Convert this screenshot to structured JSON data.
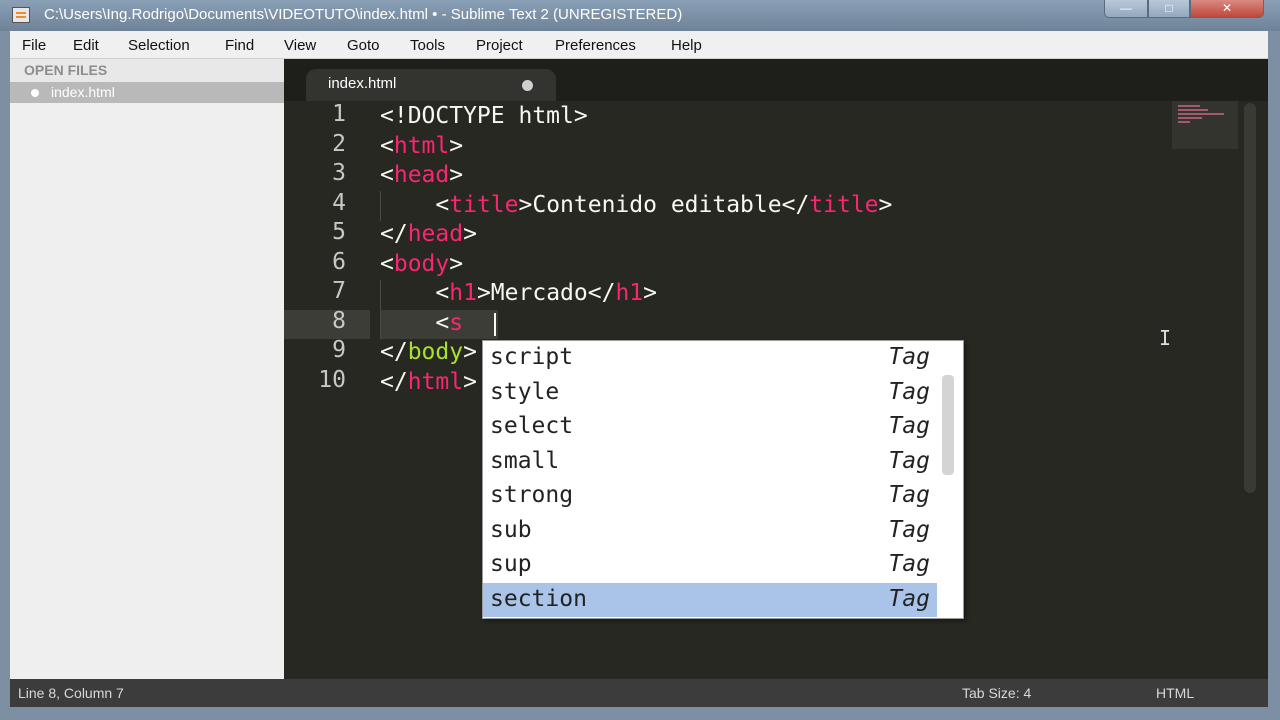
{
  "window": {
    "title": "C:\\Users\\Ing.Rodrigo\\Documents\\VIDEOTUTO\\index.html • - Sublime Text 2 (UNREGISTERED)",
    "minimize_label": "—",
    "maximize_label": "□",
    "close_label": "✕"
  },
  "menu": [
    "File",
    "Edit",
    "Selection",
    "Find",
    "View",
    "Goto",
    "Tools",
    "Project",
    "Preferences",
    "Help"
  ],
  "sidebar": {
    "header": "OPEN FILES",
    "files": [
      "index.html"
    ]
  },
  "tab": {
    "label": "index.html"
  },
  "editor": {
    "line_numbers": [
      "1",
      "2",
      "3",
      "4",
      "5",
      "6",
      "7",
      "8",
      "9",
      "10"
    ],
    "lines": [
      "<!DOCTYPE html>",
      "<html>",
      "<head>",
      "    <title>Contenido editable</title>",
      "</head>",
      "<body>",
      "    <h1>Mercado</h1>",
      "    <s",
      "</body>",
      "</html>"
    ]
  },
  "autocomplete": {
    "items": [
      {
        "word": "script",
        "kind": "Tag"
      },
      {
        "word": "style",
        "kind": "Tag"
      },
      {
        "word": "select",
        "kind": "Tag"
      },
      {
        "word": "small",
        "kind": "Tag"
      },
      {
        "word": "strong",
        "kind": "Tag"
      },
      {
        "word": "sub",
        "kind": "Tag"
      },
      {
        "word": "sup",
        "kind": "Tag"
      },
      {
        "word": "section",
        "kind": "Tag"
      }
    ],
    "selected": "section"
  },
  "status": {
    "position": "Line 8, Column 7",
    "tab_size": "Tab Size: 4",
    "syntax": "HTML"
  }
}
